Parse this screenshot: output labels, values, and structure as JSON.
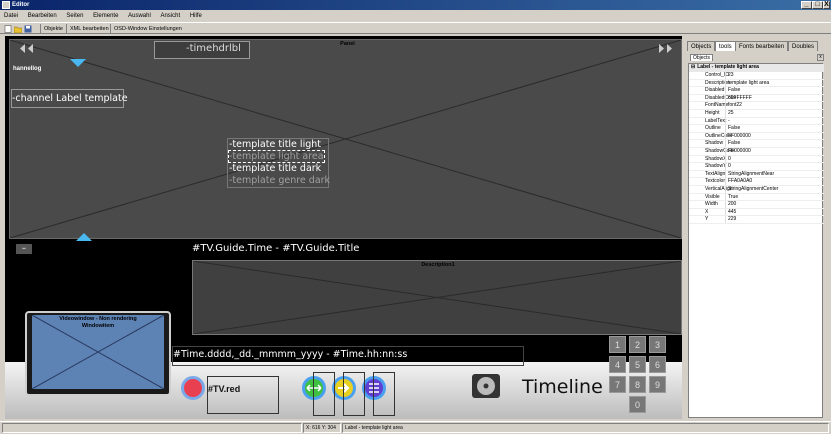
{
  "window": {
    "title": "Editor",
    "min": "_",
    "max": "□",
    "close": "X"
  },
  "menu": [
    "Datei",
    "Bearbeiten",
    "Seiten",
    "Elemente",
    "Auswahl",
    "Ansicht",
    "Hilfe"
  ],
  "toolbar": {
    "objects": "Objekte",
    "xml": "XML bearbeiten",
    "osd": "OSD-Window Einstellungen"
  },
  "canvas": {
    "panel_title": "Panel",
    "timehdr": "-timehdrlbl",
    "channel_logo": "hannellog",
    "channel_label": "-channel Label template",
    "title_light": "-template title light",
    "light_area": "-template light area",
    "title_dark": "-template title dark",
    "genre_dark": "-template genre dark",
    "guide_line": "#TV.Guide.Time - #TV.Guide.Title",
    "description": "Description1",
    "video_line1": "Videowindow - Non rendering",
    "video_line2": "Windowitem",
    "datetime": "#Time.dddd,_dd._mmmm_yyyy - #Time.hh:nn:ss",
    "tv_red": "#TV.red",
    "timeline": "Timeline",
    "numpad": [
      "1",
      "2",
      "3",
      "4",
      "5",
      "6",
      "7",
      "8",
      "9",
      "0"
    ]
  },
  "status": {
    "coords": "X: 616  Y: 304",
    "selection": "Label - template light area"
  },
  "right": {
    "tabs": [
      "Objects",
      "tools",
      "Fonts bearbeiten",
      "Doubles"
    ],
    "subtab": "Objects",
    "header": "Label - template light area",
    "properties": [
      [
        "Control_ID",
        "23"
      ],
      [
        "Description",
        "template light area"
      ],
      [
        "Disabled",
        "False"
      ],
      [
        "DisabledColor",
        "60FFFFFF"
      ],
      [
        "FontName",
        "font22"
      ],
      [
        "Height",
        "25"
      ],
      [
        "LabelText",
        "-"
      ],
      [
        "Outline",
        "False"
      ],
      [
        "OutlineColor",
        "FF000000"
      ],
      [
        "Shadow",
        "False"
      ],
      [
        "ShadowColor",
        "FF000000"
      ],
      [
        "ShadowX",
        "0"
      ],
      [
        "ShadowY",
        "0"
      ],
      [
        "TextAlign",
        "StringAlignmentNear"
      ],
      [
        "Textcolor",
        "FFA0A0A0"
      ],
      [
        "VerticalAlign",
        "StringAlignmentCenter"
      ],
      [
        "Visible",
        "True"
      ],
      [
        "Width",
        "200"
      ],
      [
        "X",
        "445"
      ],
      [
        "Y",
        "229"
      ]
    ]
  }
}
